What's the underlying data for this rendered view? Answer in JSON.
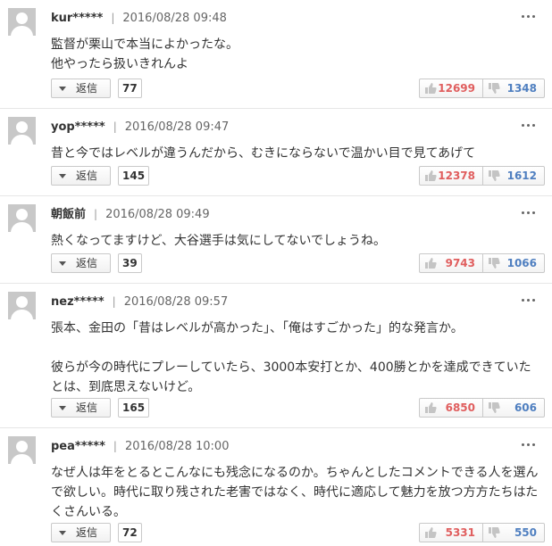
{
  "reply_label": "返信",
  "colors": {
    "like": "#e05e5e",
    "dislike": "#4f7fc0",
    "divider": "#e6e6e6"
  },
  "icons": {
    "avatar": "default-user-avatar",
    "more": "vertical-ellipsis",
    "reply_menu": "caret-down",
    "like": "thumbs-up",
    "dislike": "thumbs-down"
  },
  "comments": [
    {
      "user": "kur*****",
      "time": "2016/08/28 09:48",
      "text": "監督が栗山で本当によかったな。\n他やったら扱いきれんよ",
      "replies": "77",
      "likes": "12699",
      "dislikes": "1348"
    },
    {
      "user": "yop*****",
      "time": "2016/08/28 09:47",
      "text": "昔と今ではレベルが違うんだから、むきにならないで温かい目で見てあげて",
      "replies": "145",
      "likes": "12378",
      "dislikes": "1612"
    },
    {
      "user": "朝飯前",
      "time": "2016/08/28 09:49",
      "text": "熱くなってますけど、大谷選手は気にしてないでしょうね。",
      "replies": "39",
      "likes": "9743",
      "dislikes": "1066"
    },
    {
      "user": "nez*****",
      "time": "2016/08/28 09:57",
      "text": "張本、金田の「昔はレベルが高かった」、「俺はすごかった」的な発言か。\n\n彼らが今の時代にプレーしていたら、3000本安打とか、400勝とかを達成できていたとは、到底思えないけど。",
      "replies": "165",
      "likes": "6850",
      "dislikes": "606"
    },
    {
      "user": "pea*****",
      "time": "2016/08/28 10:00",
      "text": "なぜ人は年をとるとこんなにも残念になるのか。ちゃんとしたコメントできる人を選んで欲しい。時代に取り残された老害ではなく、時代に適応して魅力を放つ方方たちはたくさんいる。",
      "replies": "72",
      "likes": "5331",
      "dislikes": "550"
    }
  ]
}
